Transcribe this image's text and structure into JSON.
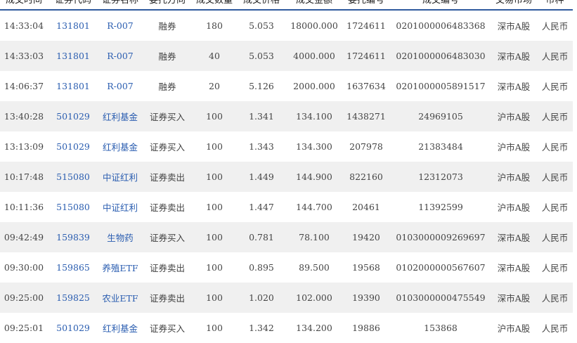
{
  "headers": [
    "成交时间",
    "证券代码",
    "证券名称",
    "委托方向",
    "成交数量",
    "成交价格",
    "成交金额",
    "委托编号",
    "成交编号",
    "交易市场",
    "币种"
  ],
  "rows": [
    [
      "14:33:04",
      "131801",
      "R-007",
      "融券",
      "180",
      "5.053",
      "18000.000",
      "1724611",
      "0201000006483368",
      "深市A股",
      "人民币"
    ],
    [
      "14:33:03",
      "131801",
      "R-007",
      "融券",
      "40",
      "5.053",
      "4000.000",
      "1724611",
      "0201000006483030",
      "深市A股",
      "人民币"
    ],
    [
      "14:06:37",
      "131801",
      "R-007",
      "融券",
      "20",
      "5.126",
      "2000.000",
      "1637634",
      "0201000005891517",
      "深市A股",
      "人民币"
    ],
    [
      "13:40:28",
      "501029",
      "红利基金",
      "证券买入",
      "100",
      "1.341",
      "134.100",
      "1438271",
      "24969105",
      "沪市A股",
      "人民币"
    ],
    [
      "13:13:09",
      "501029",
      "红利基金",
      "证券买入",
      "100",
      "1.343",
      "134.300",
      "207978",
      "21383484",
      "沪市A股",
      "人民币"
    ],
    [
      "10:17:48",
      "515080",
      "中证红利",
      "证券卖出",
      "100",
      "1.449",
      "144.900",
      "822160",
      "12312073",
      "沪市A股",
      "人民币"
    ],
    [
      "10:11:36",
      "515080",
      "中证红利",
      "证券卖出",
      "100",
      "1.447",
      "144.700",
      "20461",
      "11392599",
      "沪市A股",
      "人民币"
    ],
    [
      "09:42:49",
      "159839",
      "生物药",
      "证券买入",
      "100",
      "0.781",
      "78.100",
      "19420",
      "0103000009269697",
      "深市A股",
      "人民币"
    ],
    [
      "09:30:00",
      "159865",
      "养殖ETF",
      "证券卖出",
      "100",
      "0.895",
      "89.500",
      "19568",
      "0102000000567607",
      "深市A股",
      "人民币"
    ],
    [
      "09:25:00",
      "159825",
      "农业ETF",
      "证券卖出",
      "100",
      "1.020",
      "102.000",
      "19390",
      "0103000000475549",
      "深市A股",
      "人民币"
    ],
    [
      "09:25:01",
      "501029",
      "红利基金",
      "证券买入",
      "100",
      "1.342",
      "134.200",
      "19886",
      "153868",
      "沪市A股",
      "人民币"
    ]
  ]
}
